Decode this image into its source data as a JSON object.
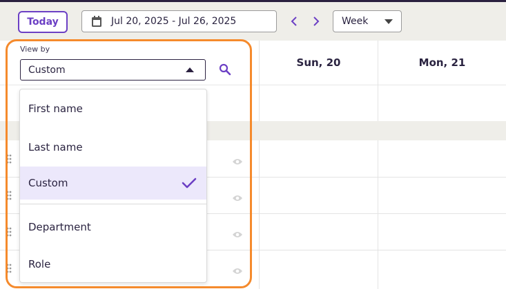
{
  "toolbar": {
    "today_label": "Today",
    "date_range": "Jul 20, 2025 - Jul 26, 2025",
    "view_mode": "Week"
  },
  "view_by": {
    "label": "View by",
    "selected": "Custom",
    "options": [
      {
        "label": "First name",
        "selected": false
      },
      {
        "label": "Last name",
        "selected": false
      },
      {
        "label": "Custom",
        "selected": true
      },
      {
        "label": "Department",
        "selected": false
      },
      {
        "label": "Role",
        "selected": false
      }
    ]
  },
  "calendar": {
    "days": [
      "Sun, 20",
      "Mon, 21"
    ]
  },
  "colors": {
    "accent": "#6b3fc4",
    "highlight": "#f58a2c",
    "selected_bg": "#ece8fb",
    "toolbar_bg": "#efeee9"
  },
  "icons": [
    "calendar-icon",
    "chevron-left-icon",
    "chevron-right-icon",
    "caret-down-icon",
    "caret-up-icon",
    "search-icon",
    "check-icon",
    "drag-handle-icon",
    "eye-icon"
  ]
}
